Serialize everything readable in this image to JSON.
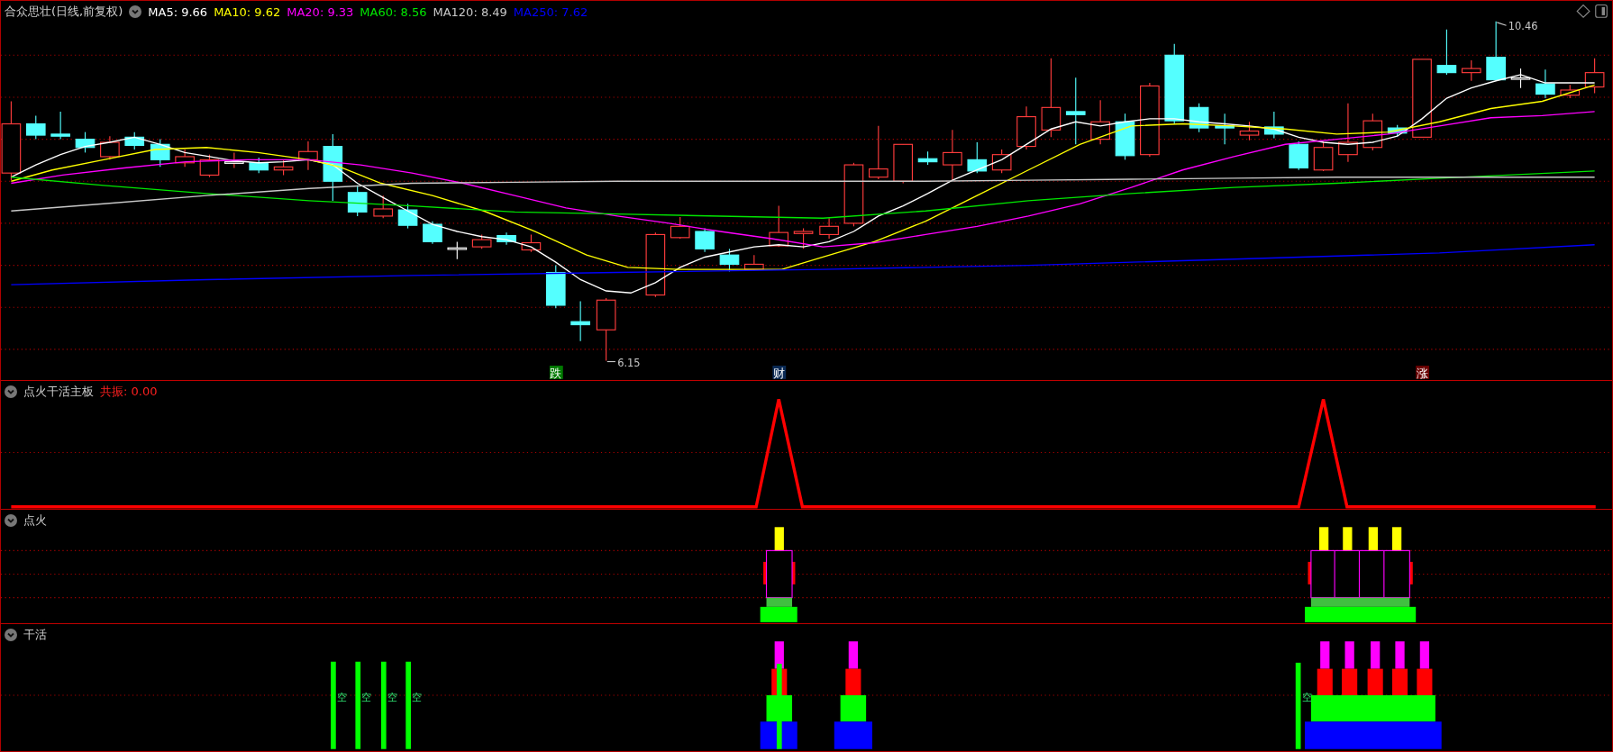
{
  "main_chart": {
    "title": "合众思壮(日线,前复权)",
    "ma_readings": [
      {
        "label": "MA5: 9.66",
        "color": "#ffffff"
      },
      {
        "label": "MA10: 9.62",
        "color": "#ffff00"
      },
      {
        "label": "MA20: 9.33",
        "color": "#ff00ff"
      },
      {
        "label": "MA60: 8.56",
        "color": "#00e600"
      },
      {
        "label": "MA120: 8.49",
        "color": "#c8c8c8"
      },
      {
        "label": "MA250: 7.62",
        "color": "#0000ff"
      }
    ],
    "high_marker": "10.46",
    "low_marker": "6.15",
    "signals": [
      {
        "text": "跌",
        "color": "#007a00"
      },
      {
        "text": "财",
        "color": "#0a2a55"
      },
      {
        "text": "涨",
        "color": "#6a0000"
      }
    ]
  },
  "resonance_panel": {
    "title": "点火干活主板",
    "reading": "共振: 0.00"
  },
  "ignition_panel": {
    "title": "点火"
  },
  "work_panel": {
    "title": "干活",
    "markers": [
      "空",
      "空",
      "空",
      "空",
      "空"
    ]
  }
}
